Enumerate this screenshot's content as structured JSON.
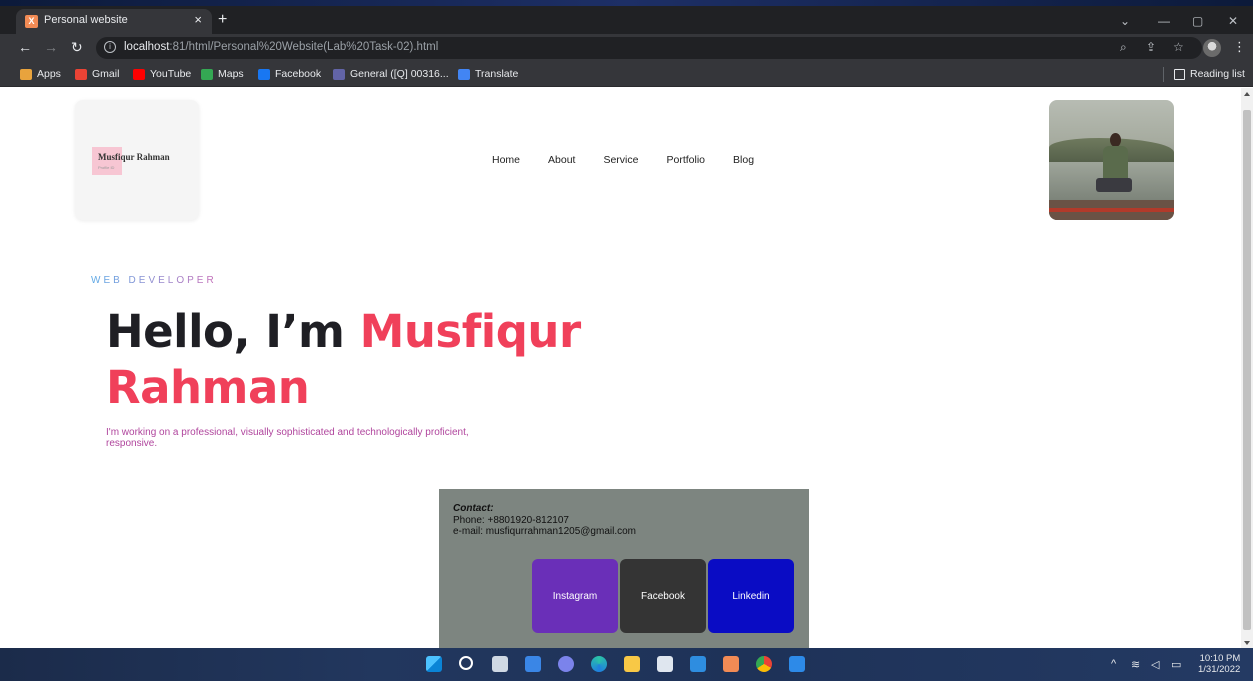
{
  "browser": {
    "tab_title": "Personal website",
    "tab_close": "×",
    "new_tab": "+",
    "url_host": "localhost",
    "url_rest": ":81/html/Personal%20Website(Lab%20Task-02).html",
    "window_controls": {
      "minimize": "—",
      "maximize": "▢",
      "close": "✕",
      "dropdown": "⌄"
    }
  },
  "bookmarks": [
    {
      "label": "Apps",
      "icon": "apps-grid-icon",
      "color": "#e8a33d"
    },
    {
      "label": "Gmail",
      "icon": "gmail-icon",
      "color": "#ea4335"
    },
    {
      "label": "YouTube",
      "icon": "youtube-icon",
      "color": "#ff0000"
    },
    {
      "label": "Maps",
      "icon": "maps-icon",
      "color": "#34a853"
    },
    {
      "label": "Facebook",
      "icon": "facebook-icon",
      "color": "#1877f2"
    },
    {
      "label": "General ([Q] 00316...",
      "icon": "teams-icon",
      "color": "#6264a7"
    },
    {
      "label": "Translate",
      "icon": "translate-icon",
      "color": "#4285f4"
    }
  ],
  "reading_list": "Reading list",
  "site": {
    "logo_name": "Musfiqur Rahman",
    "logo_sub": "Profile ID",
    "nav": [
      "Home",
      "About",
      "Service",
      "Portfolio",
      "Blog"
    ],
    "kicker": "WEB DEVELOPER",
    "hero_lead": "Hello, I’m ",
    "hero_name": "Musfiqur Rahman",
    "hero_desc": "I'm working on a professional, visually sophisticated and technologically proficient, responsive.",
    "contact": {
      "label": "Contact:",
      "phone": "Phone: +8801920-812107",
      "email": "e-mail: musfiqurrahman1205@gmail.com"
    },
    "social": [
      {
        "label": "Instagram",
        "color": "#6a2fb8"
      },
      {
        "label": "Facebook",
        "color": "#343434"
      },
      {
        "label": "Linkedin",
        "color": "#0a0cc4"
      }
    ]
  },
  "taskbar": {
    "time": "10:10 PM",
    "date": "1/31/2022"
  }
}
